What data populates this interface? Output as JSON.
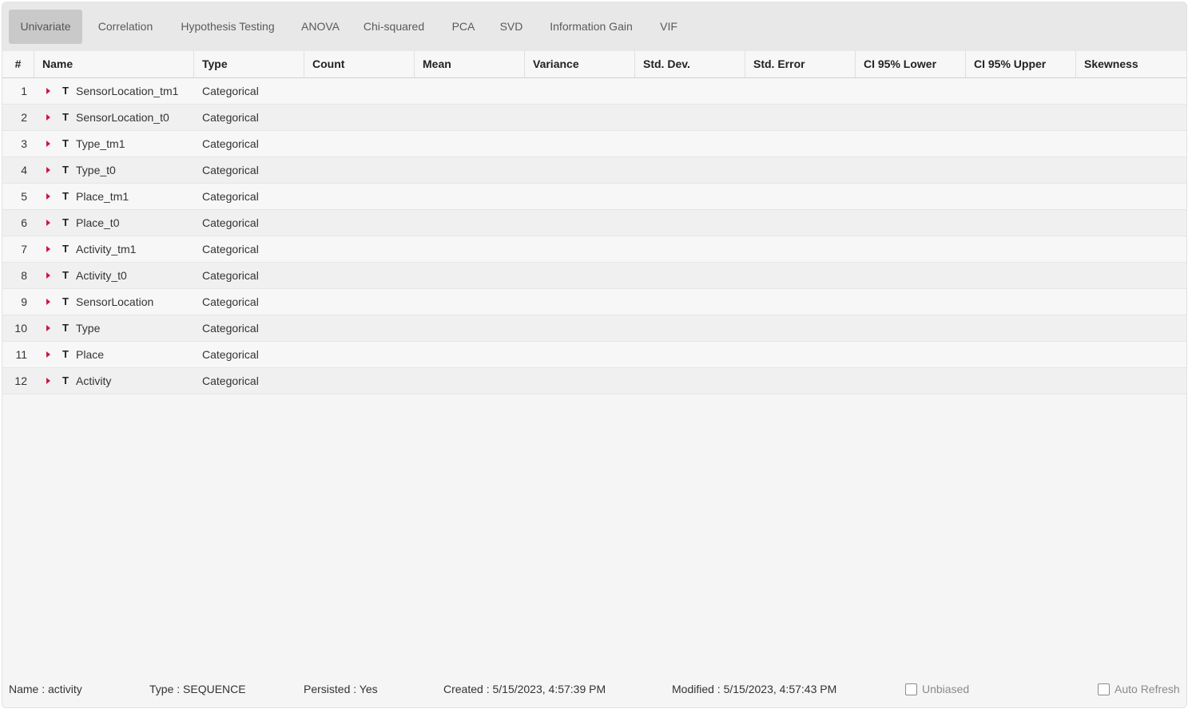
{
  "tabs": [
    {
      "label": "Univariate",
      "active": true
    },
    {
      "label": "Correlation",
      "active": false
    },
    {
      "label": "Hypothesis Testing",
      "active": false
    },
    {
      "label": "ANOVA",
      "active": false
    },
    {
      "label": "Chi-squared",
      "active": false
    },
    {
      "label": "PCA",
      "active": false
    },
    {
      "label": "SVD",
      "active": false
    },
    {
      "label": "Information Gain",
      "active": false
    },
    {
      "label": "VIF",
      "active": false
    }
  ],
  "table": {
    "columns": [
      "#",
      "Name",
      "Type",
      "Count",
      "Mean",
      "Variance",
      "Std. Dev.",
      "Std. Error",
      "CI 95% Lower",
      "CI 95% Upper",
      "Skewness"
    ],
    "type_icon": "T",
    "rows": [
      {
        "index": "1",
        "name": "SensorLocation_tm1",
        "type": "Categorical"
      },
      {
        "index": "2",
        "name": "SensorLocation_t0",
        "type": "Categorical"
      },
      {
        "index": "3",
        "name": "Type_tm1",
        "type": "Categorical"
      },
      {
        "index": "4",
        "name": "Type_t0",
        "type": "Categorical"
      },
      {
        "index": "5",
        "name": "Place_tm1",
        "type": "Categorical"
      },
      {
        "index": "6",
        "name": "Place_t0",
        "type": "Categorical"
      },
      {
        "index": "7",
        "name": "Activity_tm1",
        "type": "Categorical"
      },
      {
        "index": "8",
        "name": "Activity_t0",
        "type": "Categorical"
      },
      {
        "index": "9",
        "name": "SensorLocation",
        "type": "Categorical"
      },
      {
        "index": "10",
        "name": "Type",
        "type": "Categorical"
      },
      {
        "index": "11",
        "name": "Place",
        "type": "Categorical"
      },
      {
        "index": "12",
        "name": "Activity",
        "type": "Categorical"
      }
    ]
  },
  "footer": {
    "name": "Name : activity",
    "type": "Type : SEQUENCE",
    "persisted": "Persisted : Yes",
    "created": "Created : 5/15/2023, 4:57:39 PM",
    "modified": "Modified : 5/15/2023, 4:57:43 PM",
    "unbiased_label": "Unbiased",
    "unbiased_checked": false,
    "auto_refresh_label": "Auto Refresh",
    "auto_refresh_checked": false
  },
  "colors": {
    "expander": "#d0173f",
    "active_tab_bg": "#c9c9c9",
    "tabbar_bg": "#e8e8e8"
  },
  "icons": {
    "expander": "caret-right-icon",
    "type_glyph": "text-type-icon",
    "checkbox": "checkbox-icon"
  }
}
